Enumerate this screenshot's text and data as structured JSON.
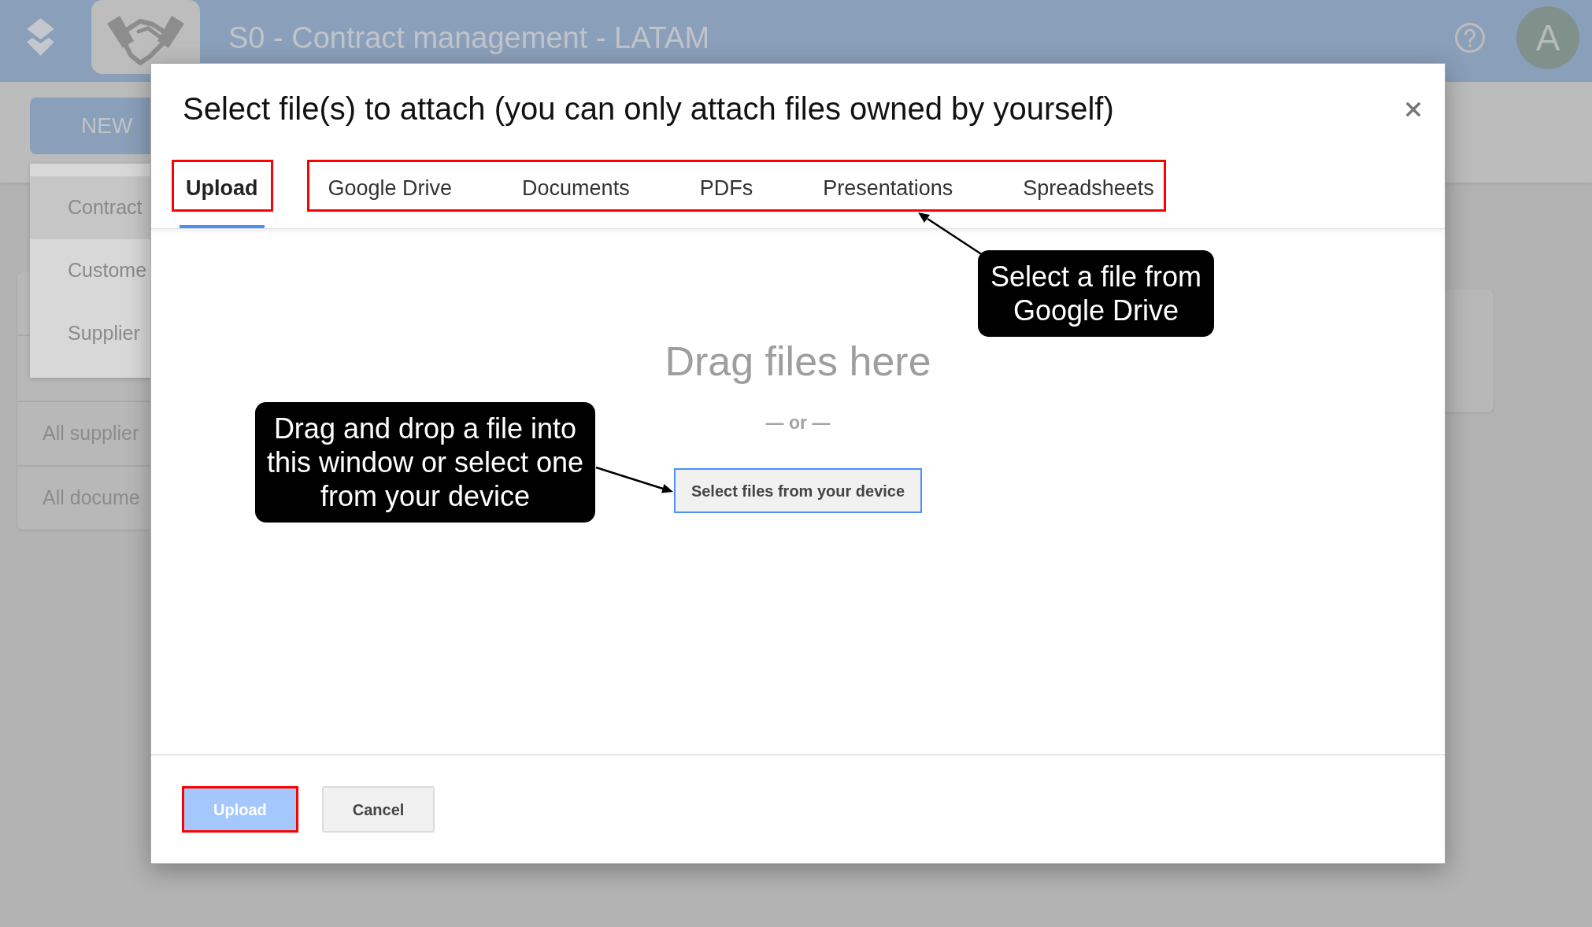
{
  "app_header": {
    "title": "S0 - Contract management - LATAM",
    "avatar_letter": "A"
  },
  "new_button": {
    "label": "NEW"
  },
  "new_menu": {
    "items": [
      {
        "label": "Contract",
        "selected": true
      },
      {
        "label": "Custome",
        "selected": false
      },
      {
        "label": "Supplier",
        "selected": false
      }
    ]
  },
  "sidebar": {
    "items": [
      {
        "label": "All supplier"
      },
      {
        "label": "All docume"
      }
    ]
  },
  "dialog": {
    "title": "Select file(s) to attach (you can only attach files owned by yourself)",
    "tab_groups": [
      {
        "highlighted": true,
        "tabs": [
          {
            "label": "Upload",
            "selected": true
          }
        ]
      },
      {
        "highlighted": true,
        "tabs": [
          {
            "label": "Google Drive",
            "selected": false
          },
          {
            "label": "Documents",
            "selected": false
          },
          {
            "label": "PDFs",
            "selected": false
          },
          {
            "label": "Presentations",
            "selected": false
          },
          {
            "label": "Spreadsheets",
            "selected": false
          }
        ]
      }
    ],
    "drop_zone": {
      "heading": "Drag files here",
      "separator": "— or —",
      "button": "Select files from your device"
    },
    "buttons": [
      {
        "label": "Upload",
        "kind": "primary",
        "highlighted": true
      },
      {
        "label": "Cancel",
        "kind": "secondary",
        "highlighted": false
      }
    ]
  },
  "callouts": [
    {
      "text": "Select a file from Google Drive"
    },
    {
      "text": "Drag and drop a file into this window or select one from your device"
    }
  ]
}
